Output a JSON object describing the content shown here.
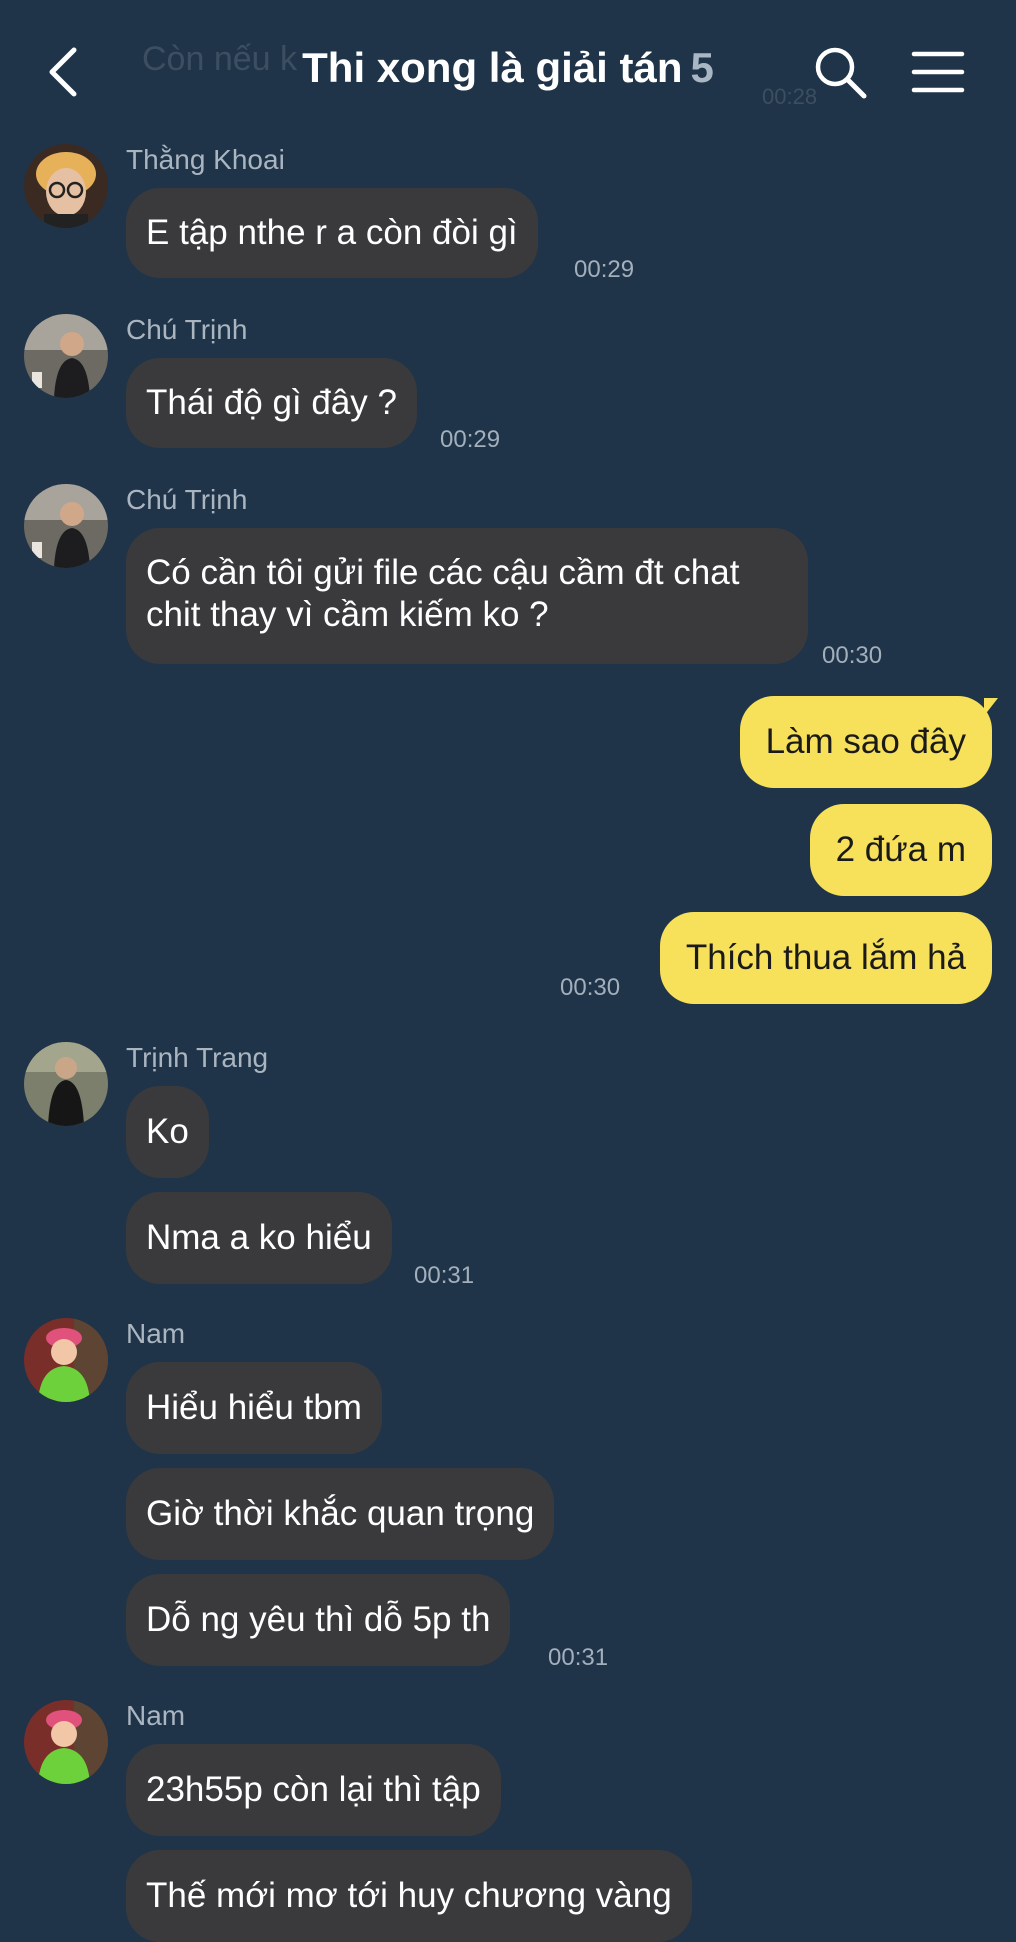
{
  "header": {
    "title": "Thi xong là giải tán",
    "member_count": "5",
    "ghost_text": "Còn nếu k",
    "ghost_time": "00:28"
  },
  "messages": [
    {
      "sender": "Thằng Khoai",
      "text": "E tập nthe r a còn đòi gì",
      "time": "00:29"
    },
    {
      "sender": "Chú Trịnh",
      "text": "Thái độ gì đây ?",
      "time": "00:29"
    },
    {
      "sender": "Chú Trịnh",
      "text_line1": "Có cần tôi gửi file các cậu cầm đt chat",
      "text_line2": "chit thay vì cầm kiếm ko ?",
      "time": "00:30"
    },
    {
      "outgoing": [
        "Làm sao đây",
        "2 đứa m",
        "Thích thua lắm hả"
      ],
      "time": "00:30"
    },
    {
      "sender": "Trịnh Trang",
      "texts": [
        "Ko",
        "Nma a ko hiểu"
      ],
      "time": "00:31"
    },
    {
      "sender": "Nam",
      "texts": [
        "Hiểu hiểu tbm",
        "Giờ thời khắc quan trọng",
        "Dỗ ng yêu thì dỗ 5p th"
      ],
      "time": "00:31"
    },
    {
      "sender": "Nam",
      "texts": [
        "23h55p còn lại thì tập",
        "Thế mới mơ tới huy chương vàng"
      ]
    }
  ],
  "colors": {
    "background": "#1f3449",
    "incoming_bubble": "#3a3a3d",
    "outgoing_bubble": "#f7e05a"
  },
  "icons": [
    "back-arrow-icon",
    "search-icon",
    "menu-icon"
  ]
}
